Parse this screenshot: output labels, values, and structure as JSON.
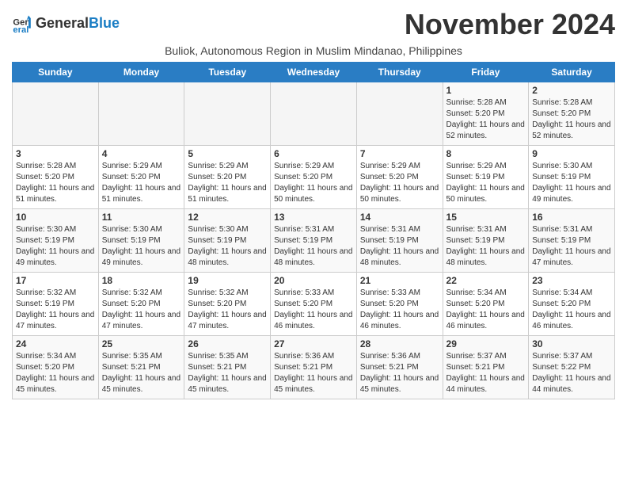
{
  "header": {
    "logo_line1": "General",
    "logo_line2": "Blue",
    "month_year": "November 2024",
    "subtitle": "Buliok, Autonomous Region in Muslim Mindanao, Philippines"
  },
  "days_of_week": [
    "Sunday",
    "Monday",
    "Tuesday",
    "Wednesday",
    "Thursday",
    "Friday",
    "Saturday"
  ],
  "weeks": [
    [
      {
        "day": "",
        "info": ""
      },
      {
        "day": "",
        "info": ""
      },
      {
        "day": "",
        "info": ""
      },
      {
        "day": "",
        "info": ""
      },
      {
        "day": "",
        "info": ""
      },
      {
        "day": "1",
        "info": "Sunrise: 5:28 AM\nSunset: 5:20 PM\nDaylight: 11 hours and 52 minutes."
      },
      {
        "day": "2",
        "info": "Sunrise: 5:28 AM\nSunset: 5:20 PM\nDaylight: 11 hours and 52 minutes."
      }
    ],
    [
      {
        "day": "3",
        "info": "Sunrise: 5:28 AM\nSunset: 5:20 PM\nDaylight: 11 hours and 51 minutes."
      },
      {
        "day": "4",
        "info": "Sunrise: 5:29 AM\nSunset: 5:20 PM\nDaylight: 11 hours and 51 minutes."
      },
      {
        "day": "5",
        "info": "Sunrise: 5:29 AM\nSunset: 5:20 PM\nDaylight: 11 hours and 51 minutes."
      },
      {
        "day": "6",
        "info": "Sunrise: 5:29 AM\nSunset: 5:20 PM\nDaylight: 11 hours and 50 minutes."
      },
      {
        "day": "7",
        "info": "Sunrise: 5:29 AM\nSunset: 5:20 PM\nDaylight: 11 hours and 50 minutes."
      },
      {
        "day": "8",
        "info": "Sunrise: 5:29 AM\nSunset: 5:19 PM\nDaylight: 11 hours and 50 minutes."
      },
      {
        "day": "9",
        "info": "Sunrise: 5:30 AM\nSunset: 5:19 PM\nDaylight: 11 hours and 49 minutes."
      }
    ],
    [
      {
        "day": "10",
        "info": "Sunrise: 5:30 AM\nSunset: 5:19 PM\nDaylight: 11 hours and 49 minutes."
      },
      {
        "day": "11",
        "info": "Sunrise: 5:30 AM\nSunset: 5:19 PM\nDaylight: 11 hours and 49 minutes."
      },
      {
        "day": "12",
        "info": "Sunrise: 5:30 AM\nSunset: 5:19 PM\nDaylight: 11 hours and 48 minutes."
      },
      {
        "day": "13",
        "info": "Sunrise: 5:31 AM\nSunset: 5:19 PM\nDaylight: 11 hours and 48 minutes."
      },
      {
        "day": "14",
        "info": "Sunrise: 5:31 AM\nSunset: 5:19 PM\nDaylight: 11 hours and 48 minutes."
      },
      {
        "day": "15",
        "info": "Sunrise: 5:31 AM\nSunset: 5:19 PM\nDaylight: 11 hours and 48 minutes."
      },
      {
        "day": "16",
        "info": "Sunrise: 5:31 AM\nSunset: 5:19 PM\nDaylight: 11 hours and 47 minutes."
      }
    ],
    [
      {
        "day": "17",
        "info": "Sunrise: 5:32 AM\nSunset: 5:19 PM\nDaylight: 11 hours and 47 minutes."
      },
      {
        "day": "18",
        "info": "Sunrise: 5:32 AM\nSunset: 5:20 PM\nDaylight: 11 hours and 47 minutes."
      },
      {
        "day": "19",
        "info": "Sunrise: 5:32 AM\nSunset: 5:20 PM\nDaylight: 11 hours and 47 minutes."
      },
      {
        "day": "20",
        "info": "Sunrise: 5:33 AM\nSunset: 5:20 PM\nDaylight: 11 hours and 46 minutes."
      },
      {
        "day": "21",
        "info": "Sunrise: 5:33 AM\nSunset: 5:20 PM\nDaylight: 11 hours and 46 minutes."
      },
      {
        "day": "22",
        "info": "Sunrise: 5:34 AM\nSunset: 5:20 PM\nDaylight: 11 hours and 46 minutes."
      },
      {
        "day": "23",
        "info": "Sunrise: 5:34 AM\nSunset: 5:20 PM\nDaylight: 11 hours and 46 minutes."
      }
    ],
    [
      {
        "day": "24",
        "info": "Sunrise: 5:34 AM\nSunset: 5:20 PM\nDaylight: 11 hours and 45 minutes."
      },
      {
        "day": "25",
        "info": "Sunrise: 5:35 AM\nSunset: 5:21 PM\nDaylight: 11 hours and 45 minutes."
      },
      {
        "day": "26",
        "info": "Sunrise: 5:35 AM\nSunset: 5:21 PM\nDaylight: 11 hours and 45 minutes."
      },
      {
        "day": "27",
        "info": "Sunrise: 5:36 AM\nSunset: 5:21 PM\nDaylight: 11 hours and 45 minutes."
      },
      {
        "day": "28",
        "info": "Sunrise: 5:36 AM\nSunset: 5:21 PM\nDaylight: 11 hours and 45 minutes."
      },
      {
        "day": "29",
        "info": "Sunrise: 5:37 AM\nSunset: 5:21 PM\nDaylight: 11 hours and 44 minutes."
      },
      {
        "day": "30",
        "info": "Sunrise: 5:37 AM\nSunset: 5:22 PM\nDaylight: 11 hours and 44 minutes."
      }
    ]
  ]
}
